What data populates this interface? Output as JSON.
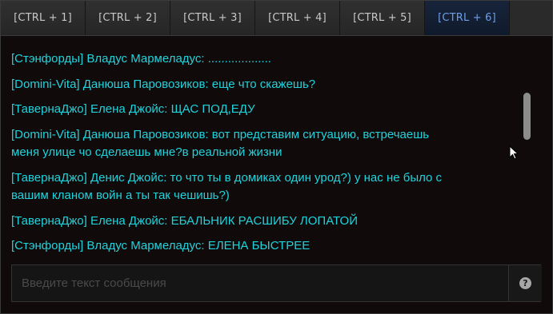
{
  "tabs": [
    {
      "label": "[CTRL + 1]",
      "active": false
    },
    {
      "label": "[CTRL + 2]",
      "active": false
    },
    {
      "label": "[CTRL + 3]",
      "active": false
    },
    {
      "label": "[CTRL + 4]",
      "active": false
    },
    {
      "label": "[CTRL + 5]",
      "active": false
    },
    {
      "label": "[CTRL + 6]",
      "active": true
    }
  ],
  "messages": [
    {
      "text": "[Стэнфорды] Владус Мармеладус: ..................."
    },
    {
      "text": "[Domini-Vita] Данюша Паровозиков: еще что скажешь?"
    },
    {
      "text": "[ТавернаДжо] Елена Джойс: ЩАС ПОД,ЕДУ"
    },
    {
      "text": "[Domini-Vita] Данюша Паровозиков: вот представим ситуацию, встречаешь меня улице чо сделаешь мне?в реальной жизни"
    },
    {
      "text": "[ТавернаДжо] Денис Джойс: то что ты в домиках один урод?) у нас не было с вашим кланом войн а ты так чешишь?)"
    },
    {
      "text": "[ТавернаДжо] Елена Джойс: ЕБАЛЬНИК РАСШИБУ ЛОПАТОЙ"
    },
    {
      "text": "[Стэнфорды] Владус Мармеладус: ЕЛЕНА БЫСТРЕЕ"
    }
  ],
  "input": {
    "placeholder": "Введите текст сообщения",
    "value": ""
  },
  "help_button": {
    "icon": "question-icon",
    "glyph": "?"
  },
  "colors": {
    "message_text": "#1fd3dd",
    "active_tab_text": "#6f9ee8",
    "tab_text": "#c8c8c8",
    "background": "#100b0a"
  }
}
